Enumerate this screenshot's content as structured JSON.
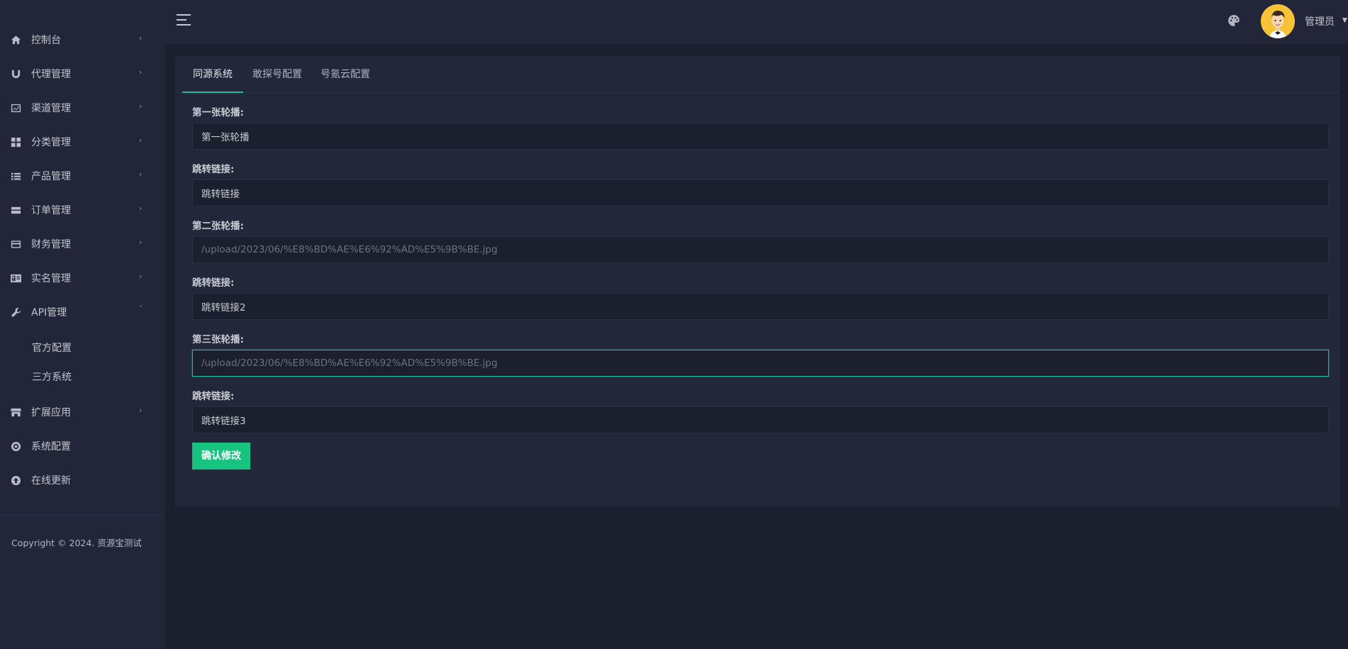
{
  "sidebar": {
    "items": [
      {
        "label": "控制台",
        "icon": "home-icon"
      },
      {
        "label": "代理管理",
        "icon": "magnet-icon"
      },
      {
        "label": "渠道管理",
        "icon": "chart-icon"
      },
      {
        "label": "分类管理",
        "icon": "grid-icon"
      },
      {
        "label": "产品管理",
        "icon": "list-icon"
      },
      {
        "label": "订单管理",
        "icon": "order-icon"
      },
      {
        "label": "财务管理",
        "icon": "card-icon"
      },
      {
        "label": "实名管理",
        "icon": "id-card-icon"
      },
      {
        "label": "API管理",
        "icon": "wrench-icon",
        "expanded": true,
        "children": [
          {
            "label": "官方配置"
          },
          {
            "label": "三方系统"
          }
        ]
      },
      {
        "label": "扩展应用",
        "icon": "store-icon"
      },
      {
        "label": "系统配置",
        "icon": "settings-icon"
      },
      {
        "label": "在线更新",
        "icon": "upload-icon"
      }
    ],
    "copyright": "Copyright © 2024. 资源宝测试"
  },
  "header": {
    "user_name": "管理员",
    "avatar_bg": "#f6c338"
  },
  "tabs": [
    {
      "label": "同源系统",
      "active": true
    },
    {
      "label": "敢探号配置",
      "active": false
    },
    {
      "label": "号氪云配置",
      "active": false
    }
  ],
  "form": {
    "fields": [
      {
        "label": "第一张轮播:",
        "value": "第一张轮播",
        "placeholder": ""
      },
      {
        "label": "跳转链接:",
        "value": "跳转链接",
        "placeholder": ""
      },
      {
        "label": "第二张轮播:",
        "value": "",
        "placeholder": "/upload/2023/06/%E8%BD%AE%E6%92%AD%E5%9B%BE.jpg"
      },
      {
        "label": "跳转链接:",
        "value": "跳转链接2",
        "placeholder": ""
      },
      {
        "label": "第三张轮播:",
        "value": "",
        "placeholder": "/upload/2023/06/%E8%BD%AE%E6%92%AD%E5%9B%BE.jpg",
        "focused": true
      },
      {
        "label": "跳转链接:",
        "value": "跳转链接3",
        "placeholder": ""
      }
    ],
    "submit_label": "确认修改"
  },
  "colors": {
    "accent": "#1bbc9b",
    "button": "#17c47f",
    "sidebar_bg": "#222638",
    "page_bg": "#1c1f2e"
  }
}
